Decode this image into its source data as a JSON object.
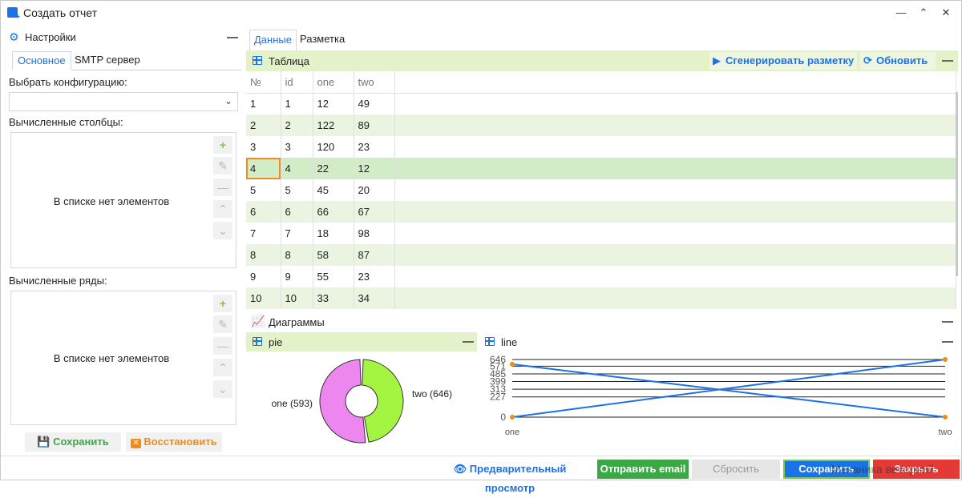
{
  "window": {
    "title": "Создать отчет"
  },
  "settings": {
    "title": "Настройки",
    "tabs": [
      "Основное",
      "SMTP сервер"
    ],
    "config_label": "Выбрать конфигурацию:",
    "config_value": "",
    "computed_columns_label": "Вычисленные столбцы:",
    "computed_rows_label": "Вычисленные ряды:",
    "empty_list_text": "В списке нет элементов",
    "save_label": "Сохранить",
    "restore_label": "Восстановить"
  },
  "main": {
    "tabs": [
      "Данные",
      "Разметка"
    ],
    "table_section": {
      "title": "Таблица",
      "generate_label": "Сгенерировать разметку",
      "refresh_label": "Обновить",
      "columns": [
        "№",
        "id",
        "one",
        "two"
      ],
      "rows": [
        [
          "1",
          "1",
          "12",
          "49"
        ],
        [
          "2",
          "2",
          "122",
          "89"
        ],
        [
          "3",
          "3",
          "120",
          "23"
        ],
        [
          "4",
          "4",
          "22",
          "12"
        ],
        [
          "5",
          "5",
          "45",
          "20"
        ],
        [
          "6",
          "6",
          "66",
          "67"
        ],
        [
          "7",
          "7",
          "18",
          "98"
        ],
        [
          "8",
          "8",
          "58",
          "87"
        ],
        [
          "9",
          "9",
          "55",
          "23"
        ],
        [
          "10",
          "10",
          "33",
          "34"
        ]
      ]
    },
    "charts_section": {
      "title": "Диаграммы"
    }
  },
  "chart_data": [
    {
      "type": "pie",
      "title": "pie",
      "categories": [
        "one",
        "two"
      ],
      "values": [
        593,
        646
      ],
      "labels": [
        "one (593)",
        "two (646)"
      ],
      "colors": [
        "#a3f542",
        "#ee86f0"
      ]
    },
    {
      "type": "line",
      "title": "line",
      "categories": [
        "one",
        "two"
      ],
      "ytick_labels": [
        "0",
        "227",
        "313",
        "399",
        "485",
        "571",
        "646"
      ],
      "series": [
        {
          "values": [
            0,
            646
          ]
        },
        {
          "values": [
            593,
            0
          ]
        }
      ],
      "ylim": [
        0,
        646
      ],
      "line_color": "#1a73e8",
      "marker_color": "#f08c1a",
      "grid": true
    }
  ],
  "footer": {
    "preview_label": "Предварительный просмотр",
    "send_email_label": "Отправить email",
    "reset_label": "Сбросить",
    "save_label": "Сохранить",
    "close_label": "Закрыть",
    "overlay_text": "Механика вечерний"
  },
  "colors": {
    "accent": "#1a73e8",
    "success": "#3aa845",
    "danger": "#e53935",
    "warning": "#f08c1a"
  }
}
